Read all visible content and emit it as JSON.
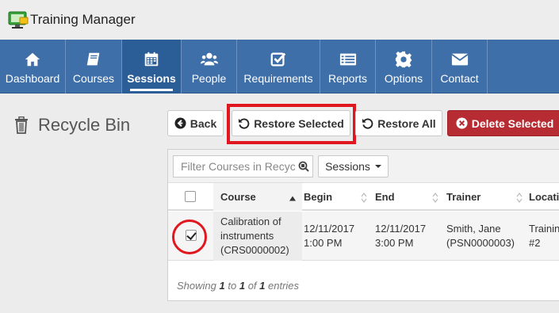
{
  "app": {
    "title": "Training Manager"
  },
  "nav": [
    {
      "label": "Dashboard",
      "icon": "home-icon"
    },
    {
      "label": "Courses",
      "icon": "book-icon"
    },
    {
      "label": "Sessions",
      "icon": "calendar-icon",
      "active": true
    },
    {
      "label": "People",
      "icon": "users-icon"
    },
    {
      "label": "Requirements",
      "icon": "checkbox-icon"
    },
    {
      "label": "Reports",
      "icon": "list-icon"
    },
    {
      "label": "Options",
      "icon": "gear-icon"
    },
    {
      "label": "Contact",
      "icon": "envelope-icon"
    }
  ],
  "page": {
    "title": "Recycle Bin"
  },
  "buttons": {
    "back": "Back",
    "restore_selected": "Restore Selected",
    "restore_all": "Restore All",
    "delete_selected": "Delete Selected"
  },
  "toolbar": {
    "filter_placeholder": "Filter Courses in Recycle",
    "dropdown_label": "Sessions"
  },
  "table": {
    "columns": [
      "Course",
      "Begin",
      "End",
      "Trainer",
      "Locatio"
    ],
    "rows": [
      {
        "checked": true,
        "course_line1": "Calibration of",
        "course_line2": "instruments",
        "course_line3": "(CRS0000002)",
        "begin_date": "12/11/2017",
        "begin_time": "1:00 PM",
        "end_date": "12/11/2017",
        "end_time": "3:00 PM",
        "trainer_name": "Smith, Jane",
        "trainer_id": "(PSN0000003)",
        "location_line1": "Trainin",
        "location_line2": "#2"
      }
    ]
  },
  "footer": {
    "showing": "Showing",
    "from": "1",
    "to_word": "to",
    "to": "1",
    "of_word": "of",
    "total": "1",
    "entries": "entries"
  },
  "colors": {
    "nav": "#3f6fa8",
    "nav_active": "#2b5e97",
    "danger": "#b72b32",
    "highlight": "#e0171f"
  }
}
